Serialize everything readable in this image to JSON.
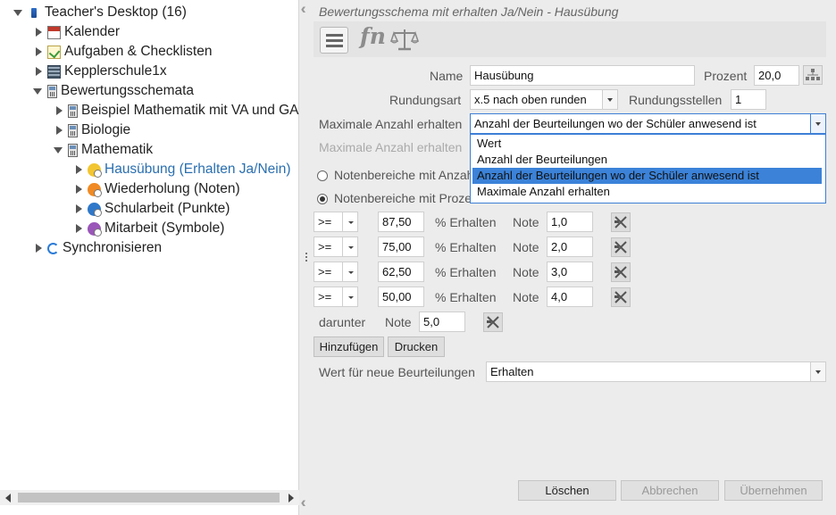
{
  "tree": {
    "root": {
      "label": "Teacher's Desktop (16)"
    },
    "items": [
      {
        "label": "Kalender",
        "icon": "calendar-icon"
      },
      {
        "label": "Aufgaben & Checklisten",
        "icon": "checklist-icon"
      },
      {
        "label": "Kepplerschule1x",
        "icon": "school-building-icon"
      },
      {
        "label": "Bewertungsschemata",
        "icon": "calculator-icon"
      },
      {
        "label": "Beispiel Mathematik mit VA und GA",
        "icon": "calculator-icon"
      },
      {
        "label": "Biologie",
        "icon": "calculator-icon"
      },
      {
        "label": "Mathematik",
        "icon": "calculator-icon"
      },
      {
        "label": "Hausübung (Erhalten Ja/Nein)",
        "icon": "yes-no-scheme-icon"
      },
      {
        "label": "Wiederholung (Noten)",
        "icon": "grades-scheme-icon"
      },
      {
        "label": "Schularbeit (Punkte)",
        "icon": "points-scheme-icon"
      },
      {
        "label": "Mitarbeit (Symbole)",
        "icon": "symbols-scheme-icon"
      },
      {
        "label": "Synchronisieren",
        "icon": "sync-icon"
      }
    ]
  },
  "header": {
    "title": "Bewertungsschema mit erhalten Ja/Nein - Hausübung"
  },
  "form": {
    "name_label": "Name",
    "name_value": "Hausübung",
    "prozent_label": "Prozent",
    "prozent_value": "20,0",
    "rundungsart_label": "Rundungsart",
    "rundungsart_value": "x.5 nach oben runden",
    "rundungsstellen_label": "Rundungsstellen",
    "rundungsstellen_value": "1",
    "max_anzahl_label": "Maximale Anzahl erhalten",
    "max_anzahl_value": "Anzahl der Beurteilungen wo der Schüler anwesend ist",
    "max_anzahl_label2": "Maximale Anzahl erhalten",
    "radio1_label": "Notenbereiche mit Anzahl",
    "radio2_label": "Notenbereiche mit Prozent"
  },
  "dropdown": {
    "options": [
      "Wert",
      "Anzahl der Beurteilungen",
      "Anzahl der Beurteilungen wo der Schüler anwesend ist",
      "Maximale Anzahl erhalten"
    ],
    "highlighted_index": 2
  },
  "ranges": [
    {
      "op": ">=",
      "value": "87,50",
      "unit": "% Erhalten",
      "note_label": "Note",
      "note": "1,0"
    },
    {
      "op": ">=",
      "value": "75,00",
      "unit": "% Erhalten",
      "note_label": "Note",
      "note": "2,0"
    },
    {
      "op": ">=",
      "value": "62,50",
      "unit": "% Erhalten",
      "note_label": "Note",
      "note": "3,0"
    },
    {
      "op": ">=",
      "value": "50,00",
      "unit": "% Erhalten",
      "note_label": "Note",
      "note": "4,0"
    }
  ],
  "below": {
    "label": "darunter",
    "note_label": "Note",
    "note": "5,0"
  },
  "buttons": {
    "add": "Hinzufügen",
    "print": "Drucken",
    "delete": "Löschen",
    "cancel": "Abbrechen",
    "apply": "Übernehmen"
  },
  "new_rating": {
    "label": "Wert für neue Beurteilungen",
    "value": "Erhalten"
  },
  "colors": {
    "accent": "#3b82d8",
    "selected_tree_text": "#2a6fb0"
  }
}
